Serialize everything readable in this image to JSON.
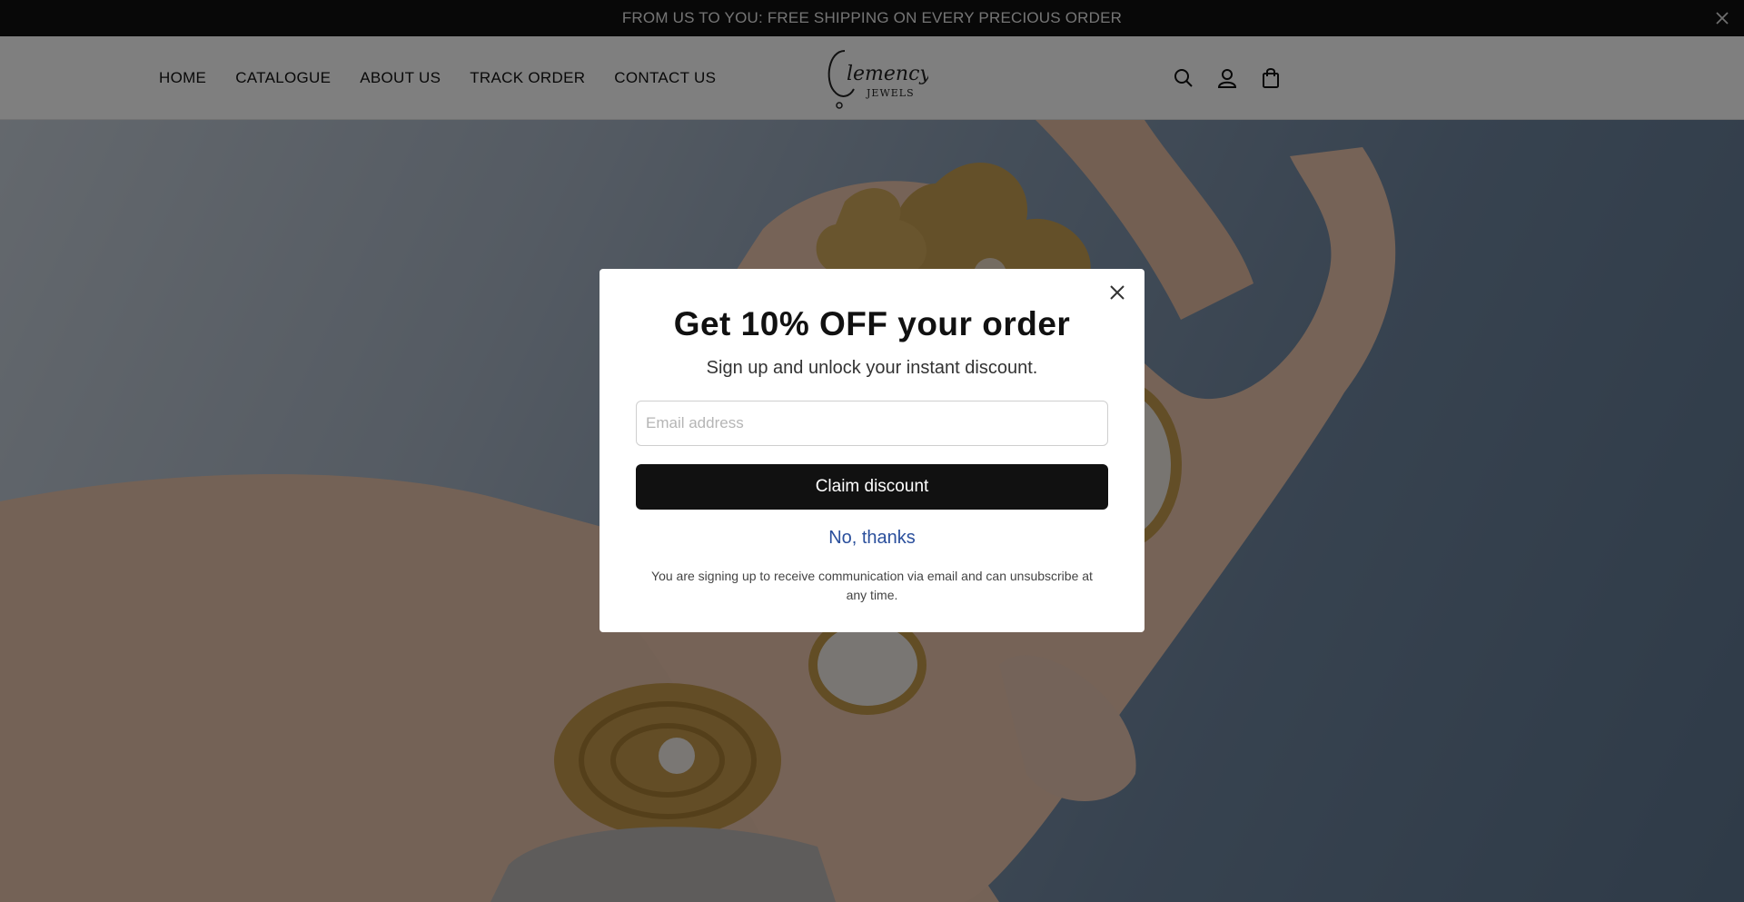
{
  "announcement": {
    "text": "FROM US TO YOU: FREE SHIPPING ON EVERY PRECIOUS ORDER"
  },
  "nav": {
    "items": [
      "HOME",
      "CATALOGUE",
      "ABOUT US",
      "TRACK ORDER",
      "CONTACT US"
    ]
  },
  "logo": {
    "line1": "Clemency",
    "line2": "JEWELS"
  },
  "header_icons": [
    "search-icon",
    "account-icon",
    "cart-bag-icon"
  ],
  "popup": {
    "title": "Get 10% OFF your order",
    "subtitle": "Sign up and unlock your instant discount.",
    "email_placeholder": "Email address",
    "email_value": "",
    "claim_label": "Claim discount",
    "decline_label": "No, thanks",
    "legal": "You are signing up to receive communication via email and can unsubscribe at any time."
  },
  "colors": {
    "announcement_bg": "#111111",
    "button_bg": "#111111",
    "link": "#2a4f9c",
    "overlay": "rgba(0,0,0,0.5)"
  }
}
